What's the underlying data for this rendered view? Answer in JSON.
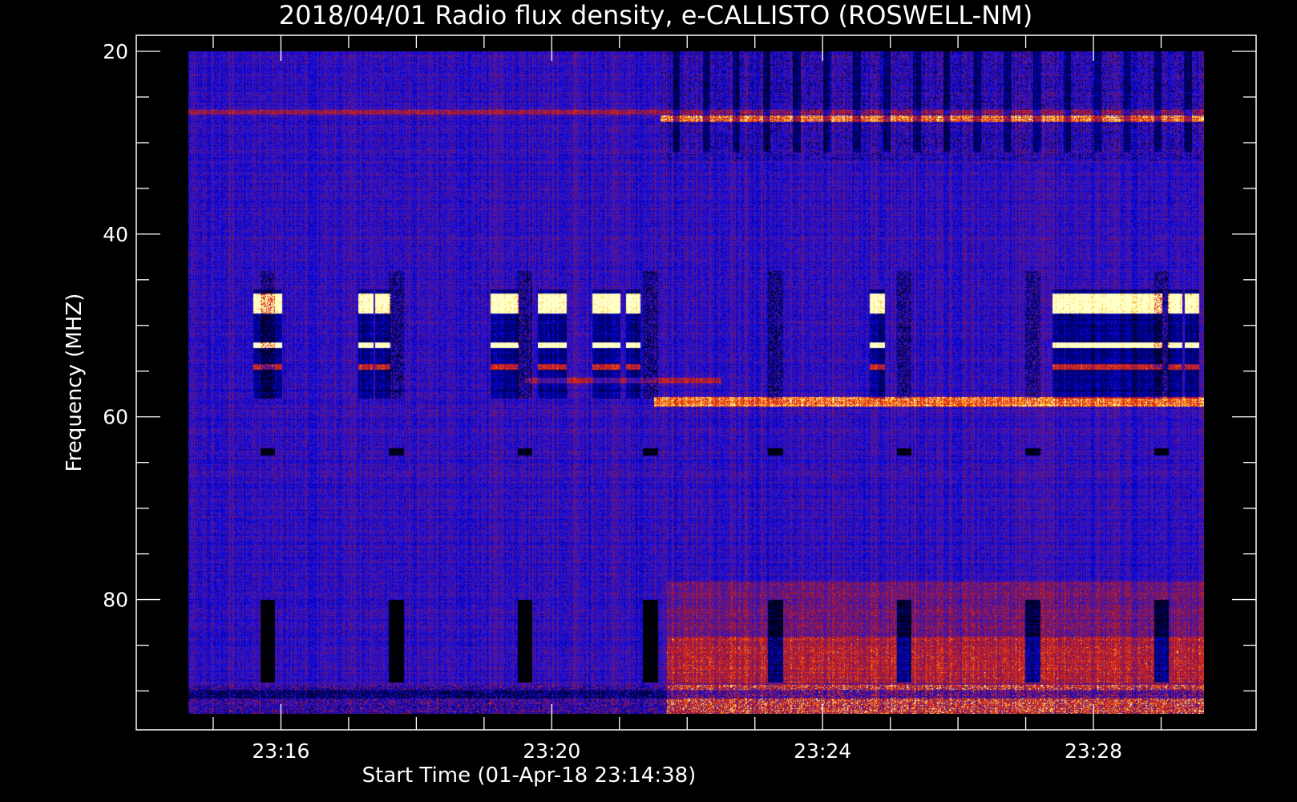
{
  "chart_data": {
    "type": "heatmap",
    "title": "2018/04/01  Radio flux density, e-CALLISTO (ROSWELL-NM)",
    "xlabel": "Start Time (01-Apr-18 23:14:38)",
    "ylabel": "Frequency (MHZ)",
    "x_axis": {
      "unit": "time of day",
      "range": [
        "23:14:38",
        "23:29:38"
      ],
      "ticks": [
        "23:16",
        "23:20",
        "23:24",
        "23:28"
      ],
      "tick_minutes": [
        16,
        20,
        24,
        28
      ]
    },
    "y_axis": {
      "unit": "MHz",
      "range": [
        20,
        92.5
      ],
      "inverted": true,
      "ticks": [
        20,
        40,
        60,
        80
      ]
    },
    "colormap": {
      "background": "#000000",
      "low": "#1a1ae6",
      "mid": "#b01818",
      "high": "#ffd22a",
      "peak": "#ffffcc"
    },
    "features": {
      "periodic_dark_sweeps_minute": [
        15.8,
        17.7,
        19.6,
        21.45,
        23.3,
        25.2,
        27.1,
        29.0
      ],
      "dark_top_band_minutes": [
        [
          21.6,
          29.9
        ]
      ],
      "emission_band_mhz": [
        46,
        54
      ],
      "emission_minutes": [
        15.7,
        15.9,
        17.25,
        17.5,
        19.2,
        19.4,
        19.9,
        20.1,
        20.7,
        20.9,
        21.2,
        24.8,
        27.5,
        27.7,
        27.9,
        28.1,
        28.3,
        28.5,
        28.7,
        28.9,
        29.2,
        29.45
      ],
      "interference_line_mhz": 58.3,
      "interference_line_start_minute": 21.5
    }
  }
}
